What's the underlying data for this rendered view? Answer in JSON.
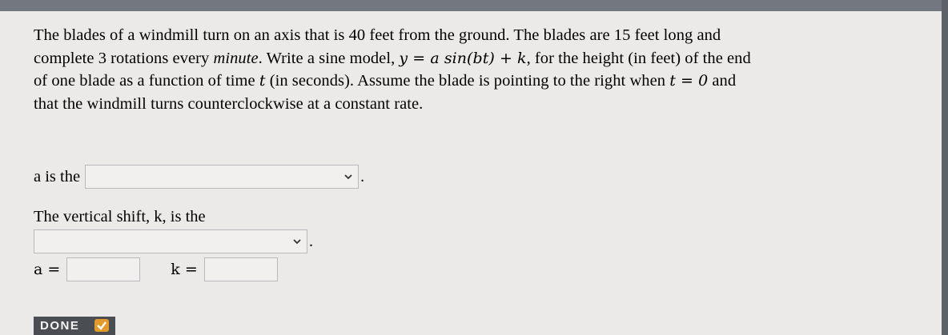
{
  "problem": {
    "line1": "The blades of a windmill turn on an axis that is 40 feet from the ground. The blades are 15 feet long and",
    "line2_a": "complete 3 rotations every ",
    "line2_em": "minute",
    "line2_b": ". Write a sine model, ",
    "line2_model": "y = a sin(bt) + k",
    "line2_c": ", for the height (in feet) of the end",
    "line3_a": "of one blade as a function of time ",
    "line3_t": "t",
    "line3_b": " (in seconds). Assume the blade is pointing to the right when ",
    "line3_cond": "t = 0",
    "line3_c": " and",
    "line4": "that the windmill turns counterclockwise at a constant rate."
  },
  "question_a": {
    "label": "a is the",
    "selected_value": "",
    "period": "."
  },
  "question_k": {
    "label": "The vertical shift, k, is the",
    "selected_value": "",
    "period": "."
  },
  "answers": {
    "a_label": "a =",
    "a_value": "",
    "k_label": "k =",
    "k_value": ""
  },
  "done_button": {
    "label": "DONE"
  },
  "colors": {
    "background": "#eceae8",
    "text": "#2a2a2c",
    "done_bg": "#4a4d52",
    "check_accent": "#e49a2a"
  }
}
